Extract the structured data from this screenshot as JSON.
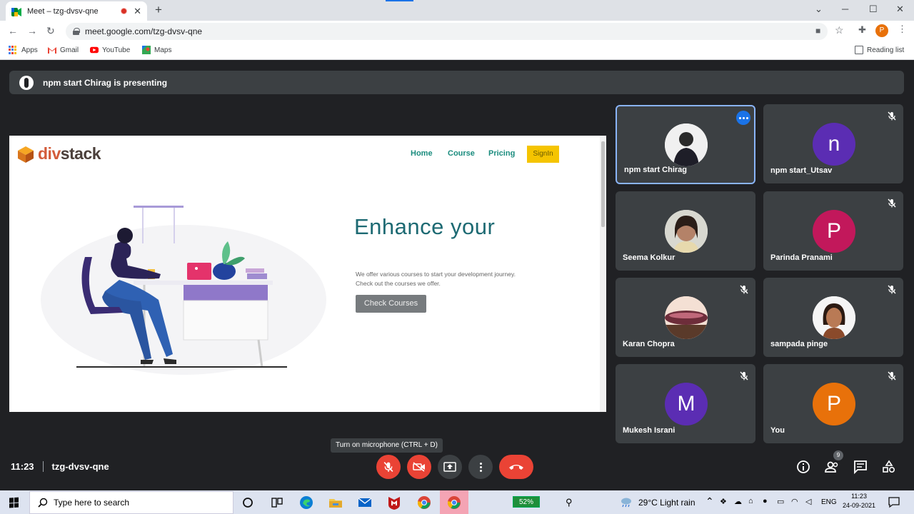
{
  "browser": {
    "tab_title": "Meet – tzg-dvsv-qne",
    "url": "meet.google.com/tzg-dvsv-qne",
    "profile_initial": "P",
    "bookmarks": [
      "Apps",
      "Gmail",
      "YouTube",
      "Maps"
    ],
    "reading_list": "Reading list"
  },
  "meet": {
    "presenting_banner": "npm start Chirag is presenting",
    "time": "11:23",
    "meeting_code": "tzg-dvsv-qne",
    "mic_tooltip": "Turn on microphone (CTRL + D)",
    "people_count": "9",
    "participants": [
      {
        "name": "npm start Chirag",
        "avatar": "photo",
        "active": true
      },
      {
        "name": "npm start_Utsav",
        "initial": "n",
        "color": "#5b2db3"
      },
      {
        "name": "Seema Kolkur",
        "avatar": "photo"
      },
      {
        "name": "Parinda Pranami",
        "initial": "P",
        "color": "#c2185b"
      },
      {
        "name": "Karan Chopra",
        "avatar": "photo"
      },
      {
        "name": "sampada pinge",
        "avatar": "photo"
      },
      {
        "name": "Mukesh Israni",
        "initial": "M",
        "color": "#5b2db3"
      },
      {
        "name": "You",
        "initial": "P",
        "color": "#e8710a"
      }
    ]
  },
  "shared_site": {
    "logo_div": "div",
    "logo_stack": "stack",
    "nav": [
      "Home",
      "Course",
      "Pricing"
    ],
    "signin": "SignIn",
    "headline": "Enhance your",
    "desc_line1": "We offer various courses to start your development journey.",
    "desc_line2": "Check out the courses we offer.",
    "cta": "Check Courses"
  },
  "taskbar": {
    "search_placeholder": "Type here to search",
    "battery": "52%",
    "weather": "29°C  Light rain",
    "language": "ENG",
    "clock_time": "11:23",
    "clock_date": "24-09-2021"
  },
  "colors": {
    "meet_bg": "#202124",
    "tile_bg": "#3c4043",
    "red": "#ea4335",
    "active_border": "#8ab4f8"
  }
}
